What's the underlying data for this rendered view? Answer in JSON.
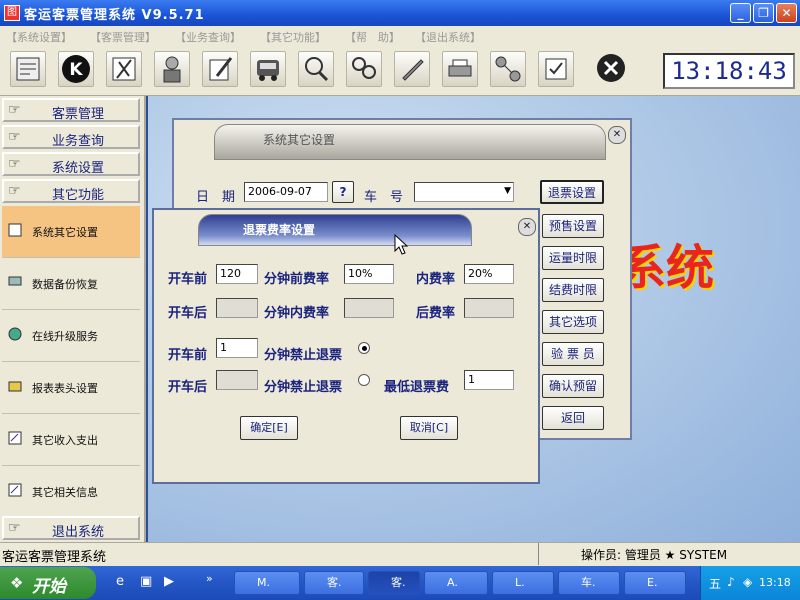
{
  "window": {
    "title": "客运客票管理系统 V9.5.71"
  },
  "menu": [
    "【系统设置】",
    "【客票管理】",
    "【业务查询】",
    "【其它功能】",
    "【帮　助】",
    "【退出系统】"
  ],
  "clock": "13:18:43",
  "sidebar": {
    "top_buttons": [
      "客票管理",
      "业务查询",
      "系统设置",
      "其它功能"
    ],
    "panels": [
      "系统其它设置",
      "数据备份恢复",
      "在线升级服务",
      "报表表头设置",
      "其它收入支出",
      "其它相关信息"
    ],
    "exit": "退出系统"
  },
  "bg_text": "系统",
  "dlg1": {
    "title": "系统其它设置",
    "date_label": "日　期",
    "date_value": "2006-09-07",
    "help_btn": "?",
    "car_label": "车　号",
    "buttons": [
      "退票设置",
      "预售设置",
      "运量时限",
      "结费时限",
      "其它选项",
      "验 票 员",
      "确认预留",
      "返回"
    ]
  },
  "dlg2": {
    "title": "退票费率设置",
    "row1": {
      "before": "开车前",
      "min_value": "120",
      "min_label": "分钟前费率",
      "rate_value": "10%",
      "inner_label": "内费率",
      "inner_value": "20%"
    },
    "row2": {
      "after": "开车后",
      "min_label": "分钟内费率",
      "post_label": "后费率"
    },
    "row3": {
      "before": "开车前",
      "value": "1",
      "label": "分钟禁止退票"
    },
    "row4": {
      "after": "开车后",
      "label": "分钟禁止退票",
      "min_fee_label": "最低退票费",
      "min_fee_value": "1"
    },
    "ok": "确定[E]",
    "cancel": "取消[C]"
  },
  "status": {
    "left": "客运客票管理系统",
    "operator": "操作员: 管理员 ★ SYSTEM"
  },
  "taskbar": {
    "start": "开始",
    "tasks": [
      "M.",
      "客.",
      "客.",
      "A.",
      "L.",
      "车.",
      "E."
    ],
    "time": "13:18"
  }
}
